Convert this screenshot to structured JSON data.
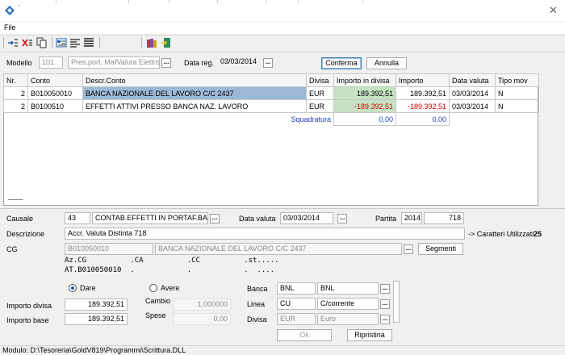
{
  "window": {
    "close_glyph": "✕"
  },
  "menu": {
    "file": "File"
  },
  "header": {
    "modello_label": "Modello",
    "modello_code": "101",
    "modello_desc": "Pres.port. MafValuta Elettroni",
    "datareg_label": "Data reg.",
    "datareg_value": "03/03/2014",
    "conferma": "Conferma",
    "annulla": "Annulla"
  },
  "grid": {
    "columns": [
      "Nr.",
      "Conto",
      "Descr.Conto",
      "Divisa",
      "Importo in divisa",
      "Importo",
      "Data valuta",
      "Tipo mov"
    ],
    "rows": [
      {
        "nr": "2",
        "conto": "B010050010",
        "descr": "BANCA NAZIONALE DEL LAVORO C/C 2437",
        "divisa": "EUR",
        "importo_divisa": "189.392,51",
        "importo": "189.392,51",
        "data_valuta": "03/03/2014",
        "tipo": "N"
      },
      {
        "nr": "2",
        "conto": "B0100510",
        "descr": "EFFETTI ATTIVI PRESSO BANCA NAZ. LAVORO",
        "divisa": "EUR",
        "importo_divisa": "-189.392,51",
        "importo": "-189.392,51",
        "data_valuta": "03/03/2014",
        "tipo": "N"
      }
    ],
    "squadratura_label": "Squadratura",
    "squadratura_divisa": "0,00",
    "squadratura_importo": "0,00"
  },
  "detail": {
    "causale_label": "Causale",
    "causale_code": "43",
    "causale_desc": "CONTAB.EFFETTI IN PORTAF.BANC",
    "datavaluta_label": "Data valuta",
    "datavaluta_value": "03/03/2014",
    "partita_label": "Partita",
    "partita_year": "2014",
    "partita_num": "718",
    "descrizione_label": "Descrizione",
    "descrizione_value": "Accr. Valuta Distinta 718",
    "caratteri_label": "-> Caratteri Utilizzati :",
    "caratteri_value": "25",
    "cg_label": "CG",
    "cg_code": "B010050010",
    "cg_desc": "BANCA NAZIONALE DEL LAVORO C/C 2437",
    "segmenti": "Segmenti",
    "seg_row1": "Az.CG          .CA          .CC          .st.....",
    "seg_row2": "AT.B010050010  .            .            .  ....",
    "dare": "Dare",
    "avere": "Avere",
    "importo_divisa_label": "Importo divisa",
    "importo_divisa_value": "189.392,51",
    "importo_base_label": "Importo base",
    "importo_base_value": "189.392,51",
    "cambio_label": "Cambio",
    "cambio_value": "1,000000",
    "spese_label": "Spese",
    "spese_value": "0,00",
    "banca_label": "Banca",
    "banca_code": "BNL",
    "banca_desc": "BNL",
    "linea_label": "Linea",
    "linea_code": "CU",
    "linea_desc": "C/corrente",
    "divisa_label": "Divisa",
    "divisa_code": "EUR",
    "divisa_desc": "Euro",
    "ok": "Ok",
    "ripristina": "Ripristina"
  },
  "status": {
    "modulo": "Modulo: D:\\Tesoreria\\GoldV819\\Programmi\\Scrittura.DLL"
  },
  "colors": {
    "selected_row": "#9db7d6",
    "green_cell": "#c5e3c2",
    "negative": "#d00000",
    "squadratura": "#1f3fbf"
  }
}
